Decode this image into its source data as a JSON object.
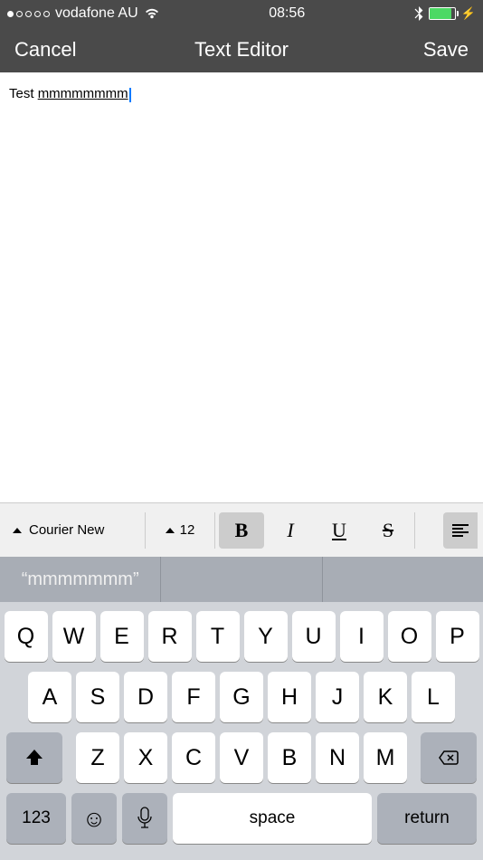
{
  "status": {
    "carrier": "vodafone AU",
    "time": "08:56"
  },
  "nav": {
    "left": "Cancel",
    "title": "Text Editor",
    "right": "Save"
  },
  "editor": {
    "plain": "Test ",
    "underlined": "mmmmmmmm"
  },
  "toolbar": {
    "font": "Courier New",
    "size": "12",
    "b": "B",
    "i": "I",
    "u": "U",
    "s": "S"
  },
  "suggest": {
    "s1": "“mmmmmmm”",
    "s2": "",
    "s3": ""
  },
  "keys": {
    "r1": [
      "Q",
      "W",
      "E",
      "R",
      "T",
      "Y",
      "U",
      "I",
      "O",
      "P"
    ],
    "r2": [
      "A",
      "S",
      "D",
      "F",
      "G",
      "H",
      "J",
      "K",
      "L"
    ],
    "r3": [
      "Z",
      "X",
      "C",
      "V",
      "B",
      "N",
      "M"
    ],
    "num": "123",
    "space": "space",
    "return": "return"
  }
}
